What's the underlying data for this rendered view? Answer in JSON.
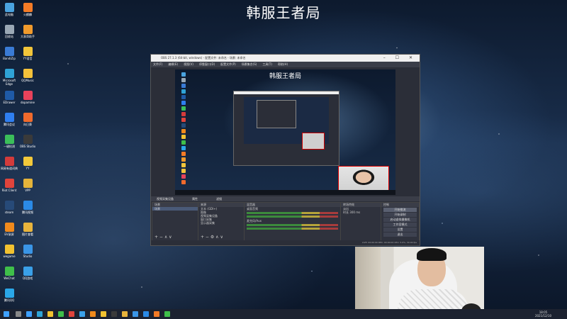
{
  "overlay_title": "韩服王者局",
  "desktop_icons": [
    {
      "label": "此电脑",
      "color": "#4aa3df"
    },
    {
      "label": "回收站",
      "color": "#9aa8b5"
    },
    {
      "label": "BandiZip",
      "color": "#3a7bd5"
    },
    {
      "label": "Microsoft Edge",
      "color": "#2fa3d6"
    },
    {
      "label": "EDrawer",
      "color": "#1f5aa6"
    },
    {
      "label": "腾讯会议",
      "color": "#2f7ff0"
    },
    {
      "label": "一键检测",
      "color": "#3bbf5a"
    },
    {
      "label": "网易有道词典",
      "color": "#d33b3b"
    },
    {
      "label": "Riot Client",
      "color": "#e0443c"
    },
    {
      "label": "steam",
      "color": "#274a78"
    },
    {
      "label": "EV录屏",
      "color": "#f08a1c"
    },
    {
      "label": "wegame",
      "color": "#f2c230"
    },
    {
      "label": "WeChat",
      "color": "#3fbf4a"
    },
    {
      "label": "腾讯QQ",
      "color": "#2aa7e8"
    },
    {
      "label": "火麒麟",
      "color": "#f47b26"
    },
    {
      "label": "大表哥助手",
      "color": "#f09a2c"
    },
    {
      "label": "YY语音",
      "color": "#f2c53a"
    },
    {
      "label": "QQMusic",
      "color": "#f5c23a"
    },
    {
      "label": "dopamine",
      "color": "#e8425b"
    },
    {
      "label": "向日葵",
      "color": "#f06a2c"
    },
    {
      "label": "OBS Studio",
      "color": "#3a3a3a"
    },
    {
      "label": "YY",
      "color": "#f3c93a"
    },
    {
      "label": "VPP",
      "color": "#e5b43a"
    },
    {
      "label": "腾讯视频",
      "color": "#2b8ae6"
    },
    {
      "label": "图片查看",
      "color": "#e8b43c"
    },
    {
      "label": "Studio",
      "color": "#3a95e6"
    },
    {
      "label": "QQ游戏",
      "color": "#3aa0e8"
    }
  ],
  "obs": {
    "title": "OBS 27.1.3 (64-bit, windows) - 配置文件: 未命名 - 场景: 未命名",
    "menu": [
      "文件(F)",
      "编辑(E)",
      "视图(V)",
      "停靠窗口(D)",
      "配置文件(P)",
      "场景集合(S)",
      "工具(T)",
      "帮助(H)"
    ],
    "preview_title": "韩服王者局",
    "tabs": [
      "视频采集设备",
      "属性",
      "滤镜"
    ],
    "scenes_header": "场景",
    "scenes": [
      "场景"
    ],
    "sources_header": "来源",
    "sources": [
      "文本 (GDI+)",
      "图像",
      "视频采集设备",
      "窗口采集",
      "显示器采集"
    ],
    "mixer_header": "混音器",
    "mixer": [
      {
        "name": "桌面音频",
        "level": "0.0 dB"
      },
      {
        "name": "麦克风/Aux",
        "level": "0.0 dB"
      }
    ],
    "transitions_header": "转场特效",
    "transition": "淡出",
    "duration_label": "时长",
    "duration": "300 ms",
    "controls_header": "控制",
    "controls": [
      "开始推流",
      "开始录制",
      "启动虚拟摄像机",
      "工作室模式",
      "设置",
      "退出"
    ],
    "status": "LIVE: 00:00:00  REC: 00:00:00  CPU: 5.0%, 30.00 fps"
  },
  "taskbar": {
    "time": "18:05",
    "date": "2021/12/10"
  }
}
